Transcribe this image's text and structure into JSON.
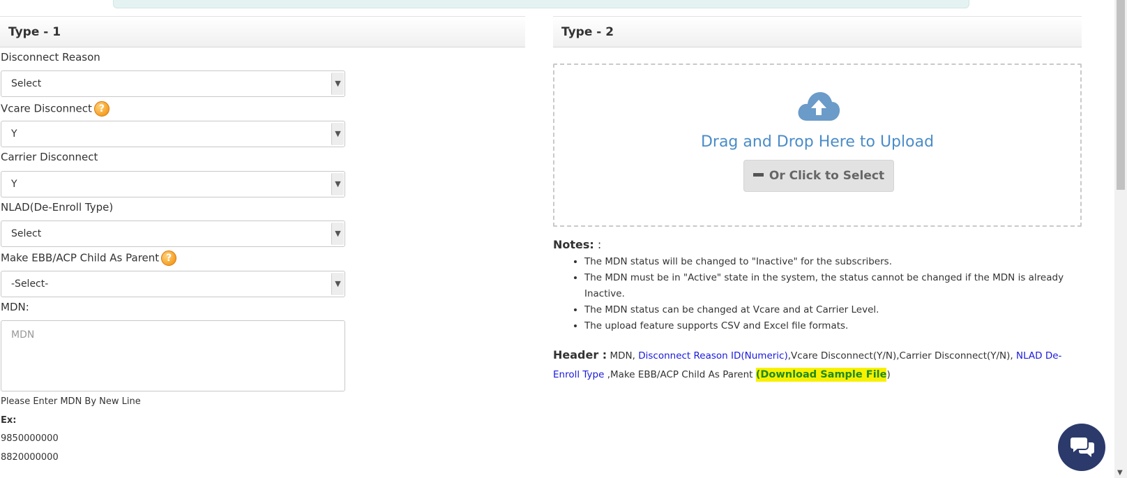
{
  "left_panel": {
    "title": "Type - 1",
    "disconnect_reason": {
      "label": "Disconnect Reason",
      "value": "Select"
    },
    "vcare_disconnect": {
      "label": "Vcare Disconnect",
      "value": "Y"
    },
    "carrier_disconnect": {
      "label": "Carrier Disconnect",
      "value": "Y"
    },
    "nlad": {
      "label": "NLAD(De-Enroll Type)",
      "value": "Select"
    },
    "make_ebb": {
      "label": "Make EBB/ACP Child As Parent",
      "value": "-Select-"
    },
    "mdn": {
      "label": "MDN:",
      "placeholder": "MDN",
      "hint": "Please Enter MDN By New Line",
      "ex_label": "Ex:",
      "examples": [
        "9850000000",
        "8820000000"
      ]
    }
  },
  "right_panel": {
    "title": "Type - 2",
    "dropzone": {
      "drag_text": "Drag and Drop Here to Upload",
      "button_label": "Or Click to Select",
      "icon": "cloud-upload-icon"
    },
    "notes": {
      "title": "Notes:",
      "suffix": " :",
      "items": [
        "The MDN status will be changed to \"Inactive\" for the subscribers.",
        "The MDN must be in \"Active\" state in the system, the status cannot be changed if the MDN is already Inactive.",
        "The MDN status can be changed at Vcare and at Carrier Level.",
        "The upload feature supports CSV and Excel file formats."
      ]
    },
    "header": {
      "key": "Header :",
      "part1": " MDN, ",
      "link1": "Disconnect Reason ID(Numeric)",
      "part2": ",Vcare Disconnect(Y/N),Carrier Disconnect(Y/N), ",
      "link2": "NLAD De-Enroll Type",
      "part3": " ,Make EBB/ACP Child As Parent ",
      "open_paren": "(",
      "download_label": "Download Sample File",
      "close_paren": ")"
    }
  },
  "chat": {
    "icon": "chat-icon"
  },
  "colors": {
    "accent_blue": "#4a8cc8",
    "link_blue": "#1a1adb",
    "download_highlight": "#f7f100",
    "download_text": "#1d8a1d",
    "chat_bg": "#2b3a6b"
  }
}
